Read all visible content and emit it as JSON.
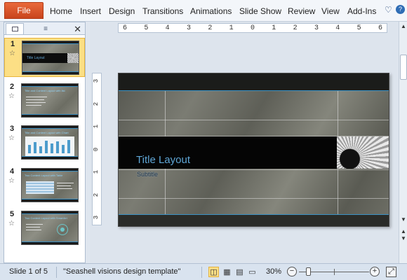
{
  "ribbon": {
    "file_label": "File",
    "tabs": [
      "Home",
      "Insert",
      "Design",
      "Transitions",
      "Animations",
      "Slide Show",
      "Review",
      "View",
      "Add-Ins"
    ],
    "minimize_icon": "chevron-up-icon",
    "help_icon": "help-icon",
    "accent": "#d9541f"
  },
  "left_pane": {
    "tab_slides_icon": "slides-icon",
    "tab_outline_icon": "outline-icon",
    "close_icon": "close-icon",
    "thumbnails": [
      {
        "number": "1",
        "title": "Title Layout",
        "selected": true
      },
      {
        "number": "2",
        "title": "Title and Content Layout with list",
        "selected": false
      },
      {
        "number": "3",
        "title": "Title and Content Layout with Chart",
        "selected": false
      },
      {
        "number": "4",
        "title": "Two Content Layout with Table",
        "selected": false
      },
      {
        "number": "5",
        "title": "Two Content Layout with SmartArt",
        "selected": false
      }
    ],
    "star_icon": "transition-star-icon"
  },
  "hruler": [
    "6",
    "5",
    "4",
    "3",
    "2",
    "1",
    "0",
    "1",
    "2",
    "3",
    "4",
    "5",
    "6"
  ],
  "vruler": [
    "3",
    "2",
    "1",
    "0",
    "1",
    "2",
    "3"
  ],
  "slide": {
    "title": "Title Layout",
    "subtitle": "Subtitle",
    "title_color": "#5fa6d6",
    "accent_line": "#3b93c6"
  },
  "status": {
    "slide_info": "Slide 1 of 5",
    "theme": "\"Seashell visions design template\"",
    "zoom": "30%",
    "views": [
      "normal-view-icon",
      "slide-sorter-icon",
      "reading-view-icon",
      "slide-show-icon"
    ],
    "fit_icon": "fit-to-window-icon"
  }
}
